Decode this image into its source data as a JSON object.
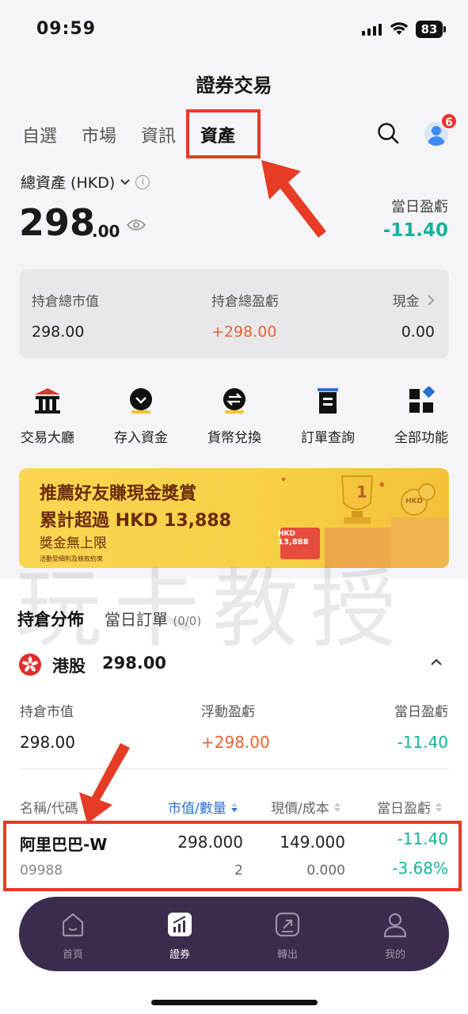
{
  "status_bar": {
    "time": "09:59",
    "battery": "83"
  },
  "header": {
    "title": "證券交易"
  },
  "tabs": [
    {
      "label": "自選"
    },
    {
      "label": "市場"
    },
    {
      "label": "資訊"
    },
    {
      "label": "資產",
      "active": true
    }
  ],
  "notification_count": "6",
  "assets": {
    "label": "總資產 (HKD)",
    "amount_int": "298",
    "amount_dec": ".00",
    "daily_pl_label": "當日盈虧",
    "daily_pl_value": "-11.40"
  },
  "summary": {
    "market_value_label": "持倉總市值",
    "market_value": "298.00",
    "total_pl_label": "持倉總盈虧",
    "total_pl": "+298.00",
    "cash_label": "現金",
    "cash": "0.00"
  },
  "functions": [
    {
      "label": "交易大廳",
      "icon": "bank-icon"
    },
    {
      "label": "存入資金",
      "icon": "deposit-icon"
    },
    {
      "label": "貨幣兌換",
      "icon": "exchange-icon"
    },
    {
      "label": "訂單查詢",
      "icon": "orders-icon"
    },
    {
      "label": "全部功能",
      "icon": "grid-icon"
    }
  ],
  "banner": {
    "line1": "推薦好友賺現金獎賞",
    "line2": "累計超過 HKD 13,888",
    "line3": "獎金無上限",
    "line4": "活動受細則及條款約束",
    "card_text_top": "HKD",
    "card_text_bottom": "13,888",
    "trophy_number": "1",
    "coin_text": "HKD"
  },
  "watermark": "玩卡教授",
  "holdings": {
    "tab_active": "持倉分佈",
    "tab_orders": "當日訂單",
    "tab_orders_count": "(0/0)",
    "market": "港股",
    "market_value": "298.00",
    "cols": {
      "mv_label": "持倉市值",
      "mv": "298.00",
      "float_label": "浮動盈虧",
      "float": "+298.00",
      "daily_label": "當日盈虧",
      "daily": "-11.40"
    },
    "table_headers": {
      "name": "名稱/代碼",
      "value_qty": "市值/數量",
      "price_cost": "現價/成本",
      "daily_pl": "當日盈虧"
    },
    "rows": [
      {
        "name": "阿里巴巴-W",
        "code": "09988",
        "market_value": "298.000",
        "quantity": "2",
        "price": "149.000",
        "cost": "0.000",
        "daily_pl": "-11.40",
        "daily_pl_pct": "-3.68%"
      }
    ]
  },
  "tabbar": [
    {
      "label": "首頁",
      "icon": "home-icon"
    },
    {
      "label": "證券",
      "icon": "securities-icon",
      "active": true
    },
    {
      "label": "轉出",
      "icon": "transfer-out-icon"
    },
    {
      "label": "我的",
      "icon": "profile-icon"
    }
  ],
  "colors": {
    "positive_orange": "#e8622f",
    "negative_green": "#16b39a",
    "highlight_red": "#e63b24",
    "tabbar_bg": "#3b2c4d"
  }
}
